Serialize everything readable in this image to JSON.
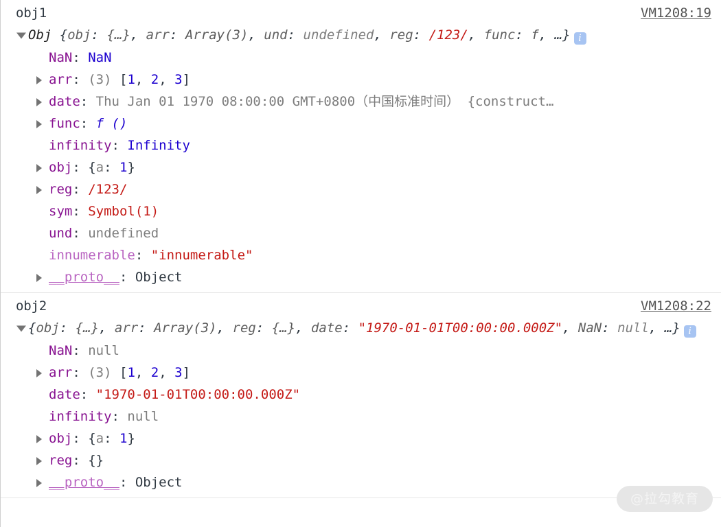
{
  "console": {
    "groups": [
      {
        "label": "obj1",
        "source_link": "VM1208:19",
        "preview": {
          "ctor": "Obj ",
          "body": "{obj: {…}, arr: Array(3), und: undefined, reg: /123/, func: f, …}",
          "segments": [
            {
              "t": "Obj ",
              "c": "ctor"
            },
            {
              "t": "{",
              "c": "punc"
            },
            {
              "t": "obj",
              "c": "pkey"
            },
            {
              "t": ": ",
              "c": "punc"
            },
            {
              "t": "{…}",
              "c": "val-obj"
            },
            {
              "t": ", ",
              "c": "punc"
            },
            {
              "t": "arr",
              "c": "pkey"
            },
            {
              "t": ": ",
              "c": "punc"
            },
            {
              "t": "Array(3)",
              "c": "val-obj"
            },
            {
              "t": ", ",
              "c": "punc"
            },
            {
              "t": "und",
              "c": "pkey"
            },
            {
              "t": ": ",
              "c": "punc"
            },
            {
              "t": "undefined",
              "c": "val-undef"
            },
            {
              "t": ", ",
              "c": "punc"
            },
            {
              "t": "reg",
              "c": "pkey"
            },
            {
              "t": ": ",
              "c": "punc"
            },
            {
              "t": "/123/",
              "c": "val-regex"
            },
            {
              "t": ", ",
              "c": "punc"
            },
            {
              "t": "func",
              "c": "pkey"
            },
            {
              "t": ": ",
              "c": "punc"
            },
            {
              "t": "f",
              "c": "val-obj"
            },
            {
              "t": ", …}",
              "c": "punc"
            }
          ],
          "info_badge": "i"
        },
        "properties": [
          {
            "expandable": false,
            "key": "NaN",
            "key_style": "key",
            "value": "NaN",
            "value_style": "v-num"
          },
          {
            "expandable": true,
            "key": "arr",
            "key_style": "key",
            "value_parts": [
              {
                "t": "(3) ",
                "c": "v-gray"
              },
              {
                "t": "[",
                "c": "bracket"
              },
              {
                "t": "1",
                "c": "v-num"
              },
              {
                "t": ", ",
                "c": "bracket"
              },
              {
                "t": "2",
                "c": "v-num"
              },
              {
                "t": ", ",
                "c": "bracket"
              },
              {
                "t": "3",
                "c": "v-num"
              },
              {
                "t": "]",
                "c": "bracket"
              }
            ]
          },
          {
            "expandable": true,
            "key": "date",
            "key_style": "key",
            "value_parts": [
              {
                "t": "Thu Jan 01 1970 08:00:00 GMT+0800（中国标准时间）",
                "c": "v-gray"
              },
              {
                "t": " {construct…",
                "c": "v-gray"
              }
            ]
          },
          {
            "expandable": true,
            "key": "func",
            "key_style": "key",
            "value_parts": [
              {
                "t": "f",
                "c": "v-func"
              },
              {
                "t": " ()",
                "c": "v-func"
              }
            ]
          },
          {
            "expandable": false,
            "key": "infinity",
            "key_style": "key",
            "value": "Infinity",
            "value_style": "v-num"
          },
          {
            "expandable": true,
            "key": "obj",
            "key_style": "key",
            "value_parts": [
              {
                "t": "{",
                "c": "bracket"
              },
              {
                "t": "a",
                "c": "inner-key"
              },
              {
                "t": ": ",
                "c": "bracket"
              },
              {
                "t": "1",
                "c": "v-num"
              },
              {
                "t": "}",
                "c": "bracket"
              }
            ]
          },
          {
            "expandable": true,
            "key": "reg",
            "key_style": "key",
            "value": "/123/",
            "value_style": "v-regex"
          },
          {
            "expandable": false,
            "key": "sym",
            "key_style": "key",
            "value": "Symbol(1)",
            "value_style": "v-sym"
          },
          {
            "expandable": false,
            "key": "und",
            "key_style": "key",
            "value": "undefined",
            "value_style": "v-undef"
          },
          {
            "expandable": false,
            "key": "innumerable",
            "key_style": "key dim",
            "value": "\"innumerable\"",
            "value_style": "v-str"
          },
          {
            "expandable": true,
            "key": "__proto__",
            "key_style": "key proto",
            "value": "Object",
            "value_style": "v-obj-name"
          }
        ]
      },
      {
        "label": "obj2",
        "source_link": "VM1208:22",
        "preview": {
          "body": "{obj: {…}, arr: Array(3), reg: {…}, date: \"1970-01-01T00:00:00.000Z\", NaN: null, …}",
          "segments": [
            {
              "t": "{",
              "c": "punc"
            },
            {
              "t": "obj",
              "c": "pkey"
            },
            {
              "t": ": ",
              "c": "punc"
            },
            {
              "t": "{…}",
              "c": "val-obj"
            },
            {
              "t": ", ",
              "c": "punc"
            },
            {
              "t": "arr",
              "c": "pkey"
            },
            {
              "t": ": ",
              "c": "punc"
            },
            {
              "t": "Array(3)",
              "c": "val-obj"
            },
            {
              "t": ", ",
              "c": "punc"
            },
            {
              "t": "reg",
              "c": "pkey"
            },
            {
              "t": ": ",
              "c": "punc"
            },
            {
              "t": "{…}",
              "c": "val-obj"
            },
            {
              "t": ", ",
              "c": "punc"
            },
            {
              "t": "date",
              "c": "pkey"
            },
            {
              "t": ": ",
              "c": "punc"
            },
            {
              "t": "\"1970-01-01T00:00:00.000Z\"",
              "c": "val-str"
            },
            {
              "t": ", ",
              "c": "punc"
            },
            {
              "t": "NaN",
              "c": "pkey"
            },
            {
              "t": ": ",
              "c": "punc"
            },
            {
              "t": "null",
              "c": "val-null"
            },
            {
              "t": ", …}",
              "c": "punc"
            }
          ],
          "info_badge": "i"
        },
        "properties": [
          {
            "expandable": false,
            "key": "NaN",
            "key_style": "key",
            "value": "null",
            "value_style": "v-null"
          },
          {
            "expandable": true,
            "key": "arr",
            "key_style": "key",
            "value_parts": [
              {
                "t": "(3) ",
                "c": "v-gray"
              },
              {
                "t": "[",
                "c": "bracket"
              },
              {
                "t": "1",
                "c": "v-num"
              },
              {
                "t": ", ",
                "c": "bracket"
              },
              {
                "t": "2",
                "c": "v-num"
              },
              {
                "t": ", ",
                "c": "bracket"
              },
              {
                "t": "3",
                "c": "v-num"
              },
              {
                "t": "]",
                "c": "bracket"
              }
            ]
          },
          {
            "expandable": false,
            "key": "date",
            "key_style": "key",
            "value": "\"1970-01-01T00:00:00.000Z\"",
            "value_style": "v-str"
          },
          {
            "expandable": false,
            "key": "infinity",
            "key_style": "key",
            "value": "null",
            "value_style": "v-null"
          },
          {
            "expandable": true,
            "key": "obj",
            "key_style": "key",
            "value_parts": [
              {
                "t": "{",
                "c": "bracket"
              },
              {
                "t": "a",
                "c": "inner-key"
              },
              {
                "t": ": ",
                "c": "bracket"
              },
              {
                "t": "1",
                "c": "v-num"
              },
              {
                "t": "}",
                "c": "bracket"
              }
            ]
          },
          {
            "expandable": true,
            "key": "reg",
            "key_style": "key",
            "value": "{}",
            "value_style": "bracket"
          },
          {
            "expandable": true,
            "key": "__proto__",
            "key_style": "key proto",
            "value": "Object",
            "value_style": "v-obj-name"
          }
        ]
      }
    ]
  },
  "watermark": {
    "text": "@拉勾教育"
  }
}
